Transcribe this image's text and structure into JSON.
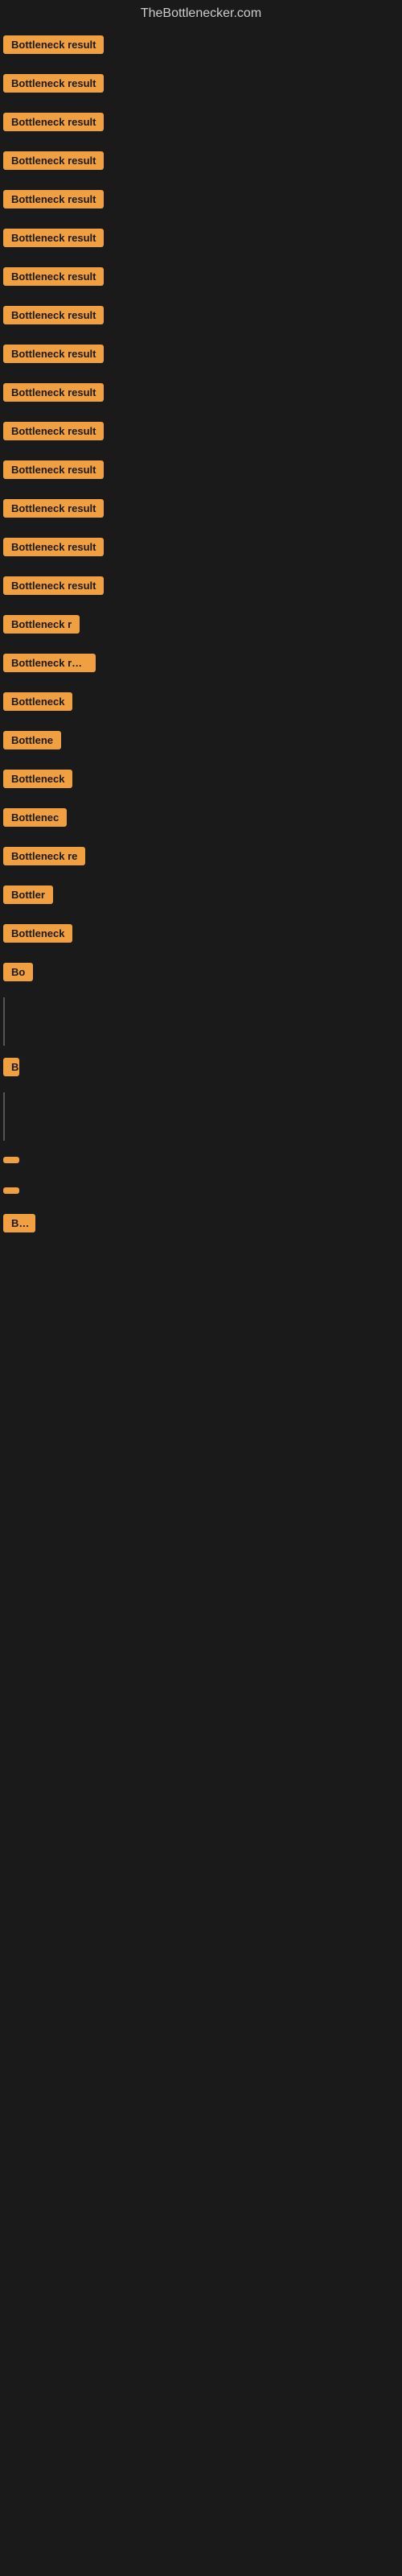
{
  "site": {
    "title": "TheBottlenecker.com"
  },
  "rows": [
    {
      "id": 1,
      "label": "Bottleneck result",
      "class": "row-1"
    },
    {
      "id": 2,
      "label": "Bottleneck result",
      "class": "row-2"
    },
    {
      "id": 3,
      "label": "Bottleneck result",
      "class": "row-3"
    },
    {
      "id": 4,
      "label": "Bottleneck result",
      "class": "row-4"
    },
    {
      "id": 5,
      "label": "Bottleneck result",
      "class": "row-5"
    },
    {
      "id": 6,
      "label": "Bottleneck result",
      "class": "row-6"
    },
    {
      "id": 7,
      "label": "Bottleneck result",
      "class": "row-7"
    },
    {
      "id": 8,
      "label": "Bottleneck result",
      "class": "row-8"
    },
    {
      "id": 9,
      "label": "Bottleneck result",
      "class": "row-9"
    },
    {
      "id": 10,
      "label": "Bottleneck result",
      "class": "row-10"
    },
    {
      "id": 11,
      "label": "Bottleneck result",
      "class": "row-11"
    },
    {
      "id": 12,
      "label": "Bottleneck result",
      "class": "row-12"
    },
    {
      "id": 13,
      "label": "Bottleneck result",
      "class": "row-13"
    },
    {
      "id": 14,
      "label": "Bottleneck result",
      "class": "row-14"
    },
    {
      "id": 15,
      "label": "Bottleneck result",
      "class": "row-15"
    },
    {
      "id": 16,
      "label": "Bottleneck r",
      "class": "row-16"
    },
    {
      "id": 17,
      "label": "Bottleneck resu",
      "class": "row-17"
    },
    {
      "id": 18,
      "label": "Bottleneck",
      "class": "row-18"
    },
    {
      "id": 19,
      "label": "Bottlene",
      "class": "row-19"
    },
    {
      "id": 20,
      "label": "Bottleneck",
      "class": "row-20"
    },
    {
      "id": 21,
      "label": "Bottlenec",
      "class": "row-21"
    },
    {
      "id": 22,
      "label": "Bottleneck re",
      "class": "row-22"
    },
    {
      "id": 23,
      "label": "Bottler",
      "class": "row-23"
    },
    {
      "id": 24,
      "label": "Bottleneck",
      "class": "row-24"
    },
    {
      "id": 25,
      "label": "Bo",
      "class": "row-25"
    },
    {
      "id": 26,
      "label": "B",
      "class": "row-26"
    },
    {
      "id": 27,
      "label": "",
      "class": "row-27"
    },
    {
      "id": 28,
      "label": "",
      "class": "row-28"
    },
    {
      "id": 29,
      "label": "Bot",
      "class": "row-29"
    }
  ],
  "colors": {
    "badge_bg": "#f0a040",
    "badge_text": "#1a1a1a",
    "page_bg": "#1a1a1a",
    "title_text": "#cccccc"
  }
}
